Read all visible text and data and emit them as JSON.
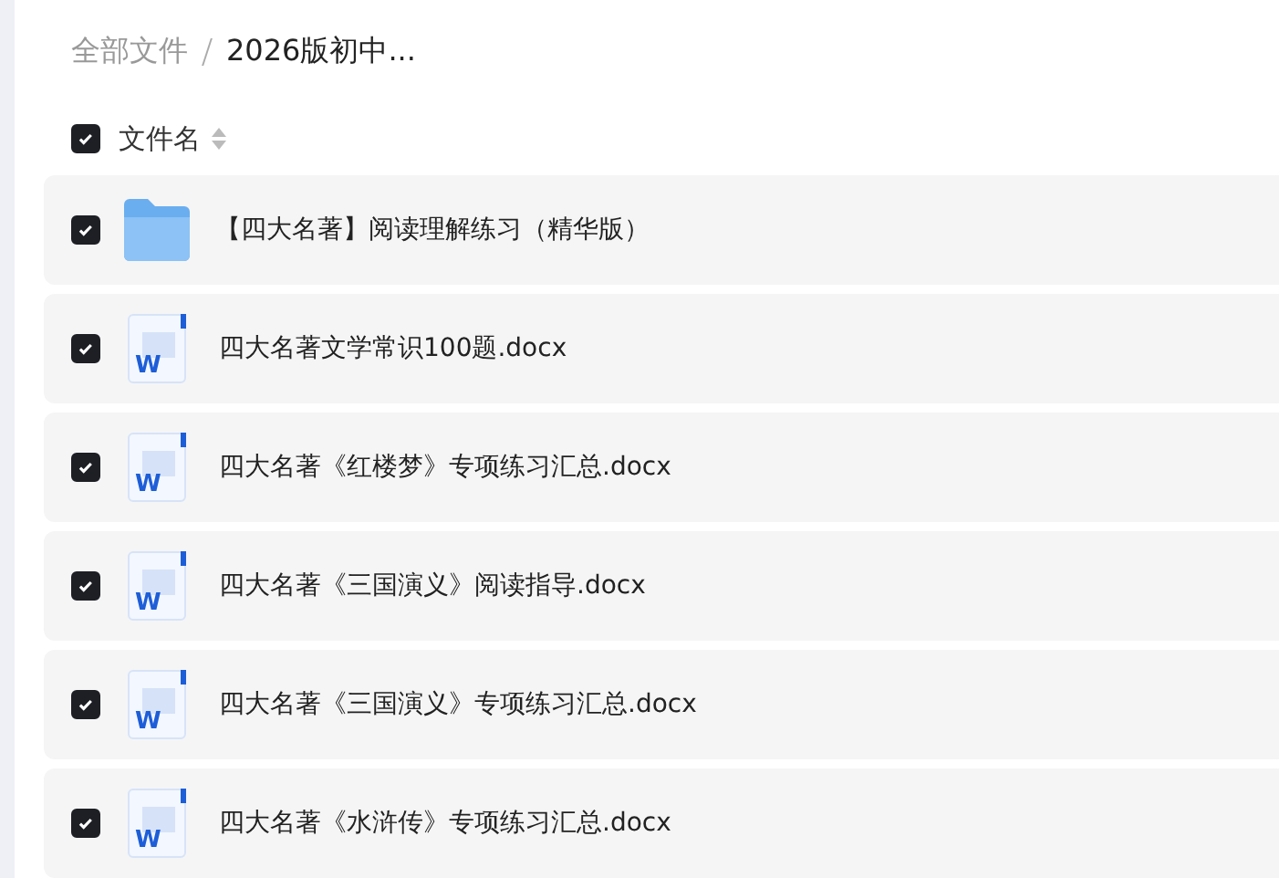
{
  "breadcrumb": [
    {
      "label": "全部文件",
      "current": false
    },
    {
      "label": "2026版初中...",
      "current": true
    }
  ],
  "header": {
    "label": "文件名",
    "checked": true
  },
  "files": [
    {
      "kind": "folder",
      "name": "【四大名著】阅读理解练习（精华版）",
      "checked": true
    },
    {
      "kind": "docx",
      "badge": "W",
      "name": "四大名著文学常识100题.docx",
      "checked": true
    },
    {
      "kind": "docx",
      "badge": "W",
      "name": "四大名著《红楼梦》专项练习汇总.docx",
      "checked": true
    },
    {
      "kind": "docx",
      "badge": "W",
      "name": "四大名著《三国演义》阅读指导.docx",
      "checked": true
    },
    {
      "kind": "docx",
      "badge": "W",
      "name": "四大名著《三国演义》专项练习汇总.docx",
      "checked": true
    },
    {
      "kind": "docx",
      "badge": "W",
      "name": "四大名著《水浒传》专项练习汇总.docx",
      "checked": true
    }
  ]
}
